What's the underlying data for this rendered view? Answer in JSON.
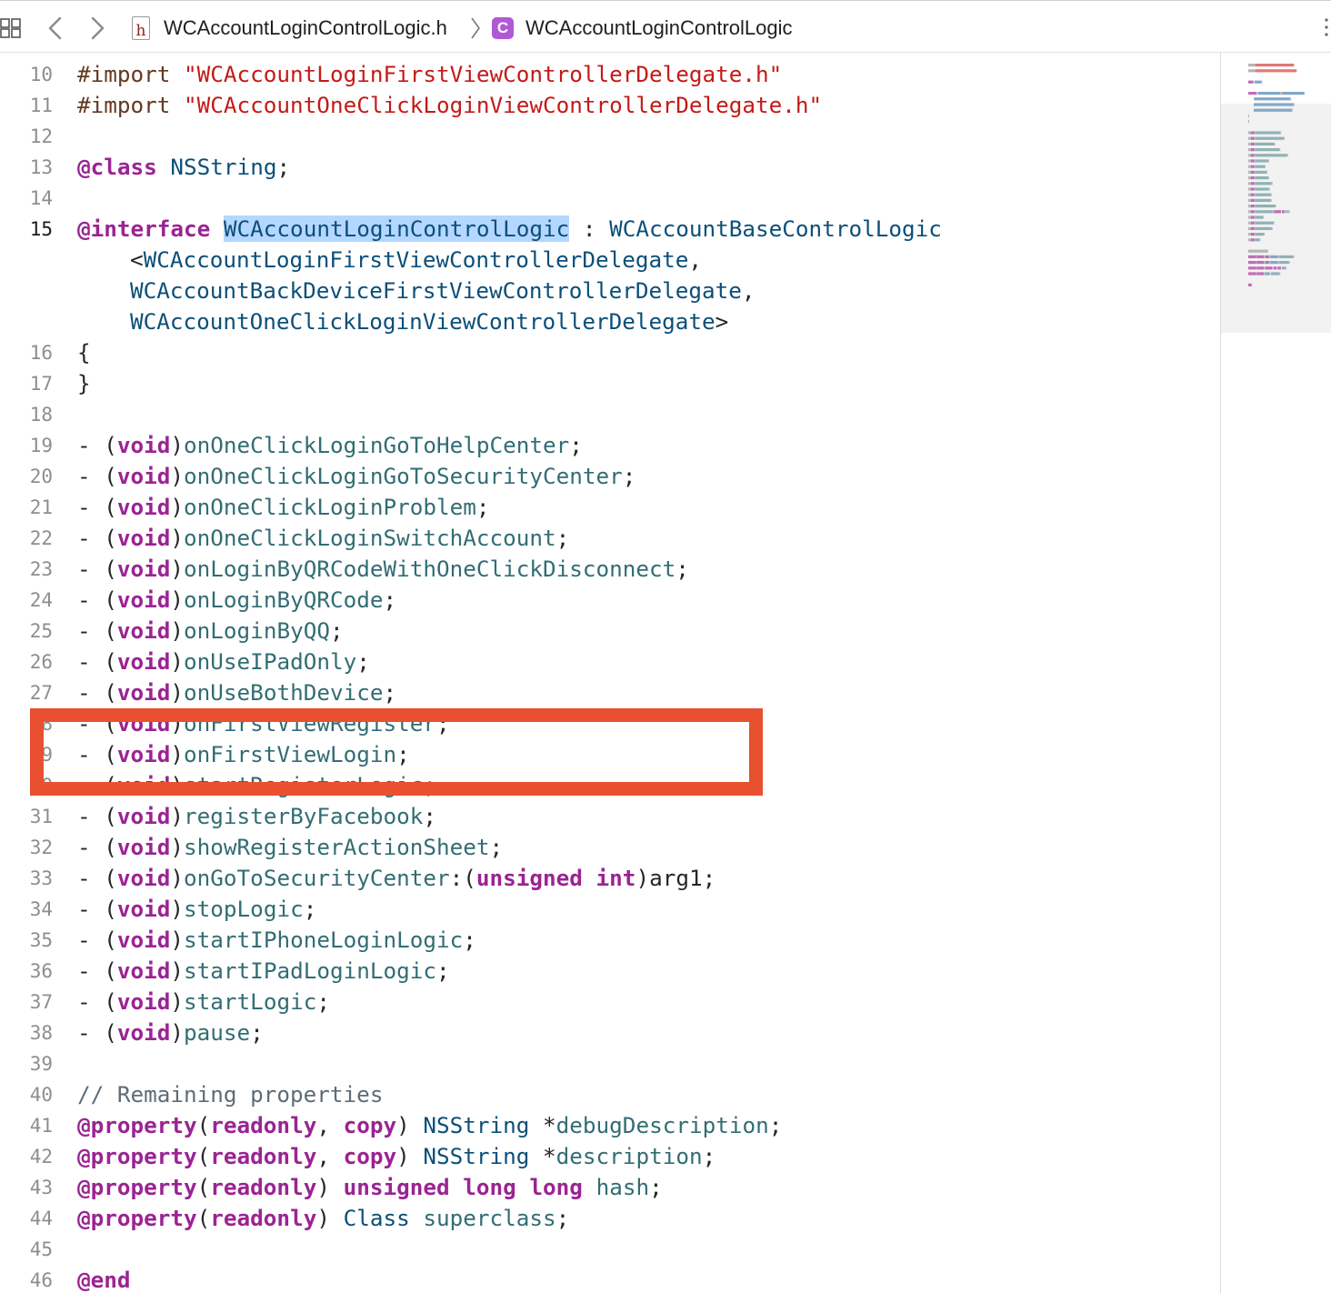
{
  "jump_bar": {
    "file_icon_glyph": "h",
    "file_name": "WCAccountLoginControlLogic.h",
    "class_icon_glyph": "C",
    "class_name": "WCAccountLoginControlLogic",
    "class_icon_color": "#b159d4"
  },
  "icons": {
    "grid": "grid-icon",
    "back": "chevron-left-icon",
    "forward": "chevron-right-icon",
    "separator": "chevron-right-icon",
    "more": "vertical-dots-icon"
  },
  "annotation": {
    "color": "#e8502f"
  },
  "editor": {
    "current_line": "15",
    "lines": [
      {
        "n": "10",
        "tokens": [
          [
            "pp",
            "#import "
          ],
          [
            "str",
            "\"WCAccountLoginFirstViewControllerDelegate.h\""
          ]
        ]
      },
      {
        "n": "11",
        "tokens": [
          [
            "pp",
            "#import "
          ],
          [
            "str",
            "\"WCAccountOneClickLoginViewControllerDelegate.h\""
          ]
        ]
      },
      {
        "n": "12",
        "tokens": []
      },
      {
        "n": "13",
        "tokens": [
          [
            "kw",
            "@class"
          ],
          [
            "p",
            " "
          ],
          [
            "ty",
            "NSString"
          ],
          [
            "p",
            ";"
          ]
        ]
      },
      {
        "n": "14",
        "tokens": []
      },
      {
        "n": "15",
        "tokens": [
          [
            "kw",
            "@interface"
          ],
          [
            "p",
            " "
          ],
          [
            "ty sel",
            "WCAccountLoginControlLogic"
          ],
          [
            "p",
            " : "
          ],
          [
            "ty",
            "WCAccountBaseControlLogic"
          ]
        ]
      },
      {
        "n": "",
        "wrap": true,
        "tokens": [
          [
            "p",
            "<"
          ],
          [
            "ty",
            "WCAccountLoginFirstViewControllerDelegate"
          ],
          [
            "p",
            ","
          ]
        ]
      },
      {
        "n": "",
        "wrap": true,
        "tokens": [
          [
            "ty",
            "WCAccountBackDeviceFirstViewControllerDelegate"
          ],
          [
            "p",
            ","
          ]
        ]
      },
      {
        "n": "",
        "wrap": true,
        "tokens": [
          [
            "ty",
            "WCAccountOneClickLoginViewControllerDelegate"
          ],
          [
            "p",
            ">"
          ]
        ]
      },
      {
        "n": "16",
        "tokens": [
          [
            "p",
            "{"
          ]
        ]
      },
      {
        "n": "17",
        "tokens": [
          [
            "p",
            "}"
          ]
        ]
      },
      {
        "n": "18",
        "tokens": []
      },
      {
        "n": "19",
        "tokens": [
          [
            "p",
            "- ("
          ],
          [
            "kw",
            "void"
          ],
          [
            "p",
            ")"
          ],
          [
            "fn",
            "onOneClickLoginGoToHelpCenter"
          ],
          [
            "p",
            ";"
          ]
        ]
      },
      {
        "n": "20",
        "tokens": [
          [
            "p",
            "- ("
          ],
          [
            "kw",
            "void"
          ],
          [
            "p",
            ")"
          ],
          [
            "fn",
            "onOneClickLoginGoToSecurityCenter"
          ],
          [
            "p",
            ";"
          ]
        ]
      },
      {
        "n": "21",
        "tokens": [
          [
            "p",
            "- ("
          ],
          [
            "kw",
            "void"
          ],
          [
            "p",
            ")"
          ],
          [
            "fn",
            "onOneClickLoginProblem"
          ],
          [
            "p",
            ";"
          ]
        ]
      },
      {
        "n": "22",
        "tokens": [
          [
            "p",
            "- ("
          ],
          [
            "kw",
            "void"
          ],
          [
            "p",
            ")"
          ],
          [
            "fn",
            "onOneClickLoginSwitchAccount"
          ],
          [
            "p",
            ";"
          ]
        ]
      },
      {
        "n": "23",
        "tokens": [
          [
            "p",
            "- ("
          ],
          [
            "kw",
            "void"
          ],
          [
            "p",
            ")"
          ],
          [
            "fn",
            "onLoginByQRCodeWithOneClickDisconnect"
          ],
          [
            "p",
            ";"
          ]
        ]
      },
      {
        "n": "24",
        "tokens": [
          [
            "p",
            "- ("
          ],
          [
            "kw",
            "void"
          ],
          [
            "p",
            ")"
          ],
          [
            "fn",
            "onLoginByQRCode"
          ],
          [
            "p",
            ";"
          ]
        ]
      },
      {
        "n": "25",
        "tokens": [
          [
            "p",
            "- ("
          ],
          [
            "kw",
            "void"
          ],
          [
            "p",
            ")"
          ],
          [
            "fn",
            "onLoginByQQ"
          ],
          [
            "p",
            ";"
          ]
        ]
      },
      {
        "n": "26",
        "tokens": [
          [
            "p",
            "- ("
          ],
          [
            "kw",
            "void"
          ],
          [
            "p",
            ")"
          ],
          [
            "fn",
            "onUseIPadOnly"
          ],
          [
            "p",
            ";"
          ]
        ]
      },
      {
        "n": "27",
        "tokens": [
          [
            "p",
            "- ("
          ],
          [
            "kw",
            "void"
          ],
          [
            "p",
            ")"
          ],
          [
            "fn",
            "onUseBothDevice"
          ],
          [
            "p",
            ";"
          ]
        ]
      },
      {
        "n": "28",
        "tokens": [
          [
            "p",
            "- ("
          ],
          [
            "kw",
            "void"
          ],
          [
            "p",
            ")"
          ],
          [
            "fn",
            "onFirstViewRegister"
          ],
          [
            "p",
            ";"
          ]
        ]
      },
      {
        "n": "29",
        "tokens": [
          [
            "p",
            "- ("
          ],
          [
            "kw",
            "void"
          ],
          [
            "p",
            ")"
          ],
          [
            "fn",
            "onFirstViewLogin"
          ],
          [
            "p",
            ";"
          ]
        ]
      },
      {
        "n": "30",
        "tokens": [
          [
            "p",
            "- ("
          ],
          [
            "kw",
            "void"
          ],
          [
            "p",
            ")"
          ],
          [
            "fn",
            "startRegisterLogic"
          ],
          [
            "p",
            ";"
          ]
        ]
      },
      {
        "n": "31",
        "tokens": [
          [
            "p",
            "- ("
          ],
          [
            "kw",
            "void"
          ],
          [
            "p",
            ")"
          ],
          [
            "fn",
            "registerByFacebook"
          ],
          [
            "p",
            ";"
          ]
        ]
      },
      {
        "n": "32",
        "tokens": [
          [
            "p",
            "- ("
          ],
          [
            "kw",
            "void"
          ],
          [
            "p",
            ")"
          ],
          [
            "fn",
            "showRegisterActionSheet"
          ],
          [
            "p",
            ";"
          ]
        ]
      },
      {
        "n": "33",
        "tokens": [
          [
            "p",
            "- ("
          ],
          [
            "kw",
            "void"
          ],
          [
            "p",
            ")"
          ],
          [
            "fn",
            "onGoToSecurityCenter"
          ],
          [
            "p",
            ":("
          ],
          [
            "kw",
            "unsigned"
          ],
          [
            "p",
            " "
          ],
          [
            "kw",
            "int"
          ],
          [
            "p",
            ")arg1;"
          ]
        ]
      },
      {
        "n": "34",
        "tokens": [
          [
            "p",
            "- ("
          ],
          [
            "kw",
            "void"
          ],
          [
            "p",
            ")"
          ],
          [
            "fn",
            "stopLogic"
          ],
          [
            "p",
            ";"
          ]
        ]
      },
      {
        "n": "35",
        "tokens": [
          [
            "p",
            "- ("
          ],
          [
            "kw",
            "void"
          ],
          [
            "p",
            ")"
          ],
          [
            "fn",
            "startIPhoneLoginLogic"
          ],
          [
            "p",
            ";"
          ]
        ]
      },
      {
        "n": "36",
        "tokens": [
          [
            "p",
            "- ("
          ],
          [
            "kw",
            "void"
          ],
          [
            "p",
            ")"
          ],
          [
            "fn",
            "startIPadLoginLogic"
          ],
          [
            "p",
            ";"
          ]
        ]
      },
      {
        "n": "37",
        "tokens": [
          [
            "p",
            "- ("
          ],
          [
            "kw",
            "void"
          ],
          [
            "p",
            ")"
          ],
          [
            "fn",
            "startLogic"
          ],
          [
            "p",
            ";"
          ]
        ]
      },
      {
        "n": "38",
        "tokens": [
          [
            "p",
            "- ("
          ],
          [
            "kw",
            "void"
          ],
          [
            "p",
            ")"
          ],
          [
            "fn",
            "pause"
          ],
          [
            "p",
            ";"
          ]
        ]
      },
      {
        "n": "39",
        "tokens": []
      },
      {
        "n": "40",
        "tokens": [
          [
            "cm",
            "// Remaining properties"
          ]
        ]
      },
      {
        "n": "41",
        "tokens": [
          [
            "kw",
            "@property"
          ],
          [
            "p",
            "("
          ],
          [
            "kw",
            "readonly"
          ],
          [
            "p",
            ", "
          ],
          [
            "kw",
            "copy"
          ],
          [
            "p",
            ") "
          ],
          [
            "ty",
            "NSString"
          ],
          [
            "p",
            " *"
          ],
          [
            "fn",
            "debugDescription"
          ],
          [
            "p",
            ";"
          ]
        ]
      },
      {
        "n": "42",
        "tokens": [
          [
            "kw",
            "@property"
          ],
          [
            "p",
            "("
          ],
          [
            "kw",
            "readonly"
          ],
          [
            "p",
            ", "
          ],
          [
            "kw",
            "copy"
          ],
          [
            "p",
            ") "
          ],
          [
            "ty",
            "NSString"
          ],
          [
            "p",
            " *"
          ],
          [
            "fn",
            "description"
          ],
          [
            "p",
            ";"
          ]
        ]
      },
      {
        "n": "43",
        "tokens": [
          [
            "kw",
            "@property"
          ],
          [
            "p",
            "("
          ],
          [
            "kw",
            "readonly"
          ],
          [
            "p",
            ") "
          ],
          [
            "kw",
            "unsigned"
          ],
          [
            "p",
            " "
          ],
          [
            "kw",
            "long"
          ],
          [
            "p",
            " "
          ],
          [
            "kw",
            "long"
          ],
          [
            "p",
            " "
          ],
          [
            "fn",
            "hash"
          ],
          [
            "p",
            ";"
          ]
        ]
      },
      {
        "n": "44",
        "tokens": [
          [
            "kw",
            "@property"
          ],
          [
            "p",
            "("
          ],
          [
            "kw",
            "readonly"
          ],
          [
            "p",
            ") "
          ],
          [
            "ty",
            "Class"
          ],
          [
            "p",
            " "
          ],
          [
            "fn",
            "superclass"
          ],
          [
            "p",
            ";"
          ]
        ]
      },
      {
        "n": "45",
        "tokens": []
      },
      {
        "n": "46",
        "tokens": [
          [
            "kw",
            "@end"
          ]
        ]
      }
    ]
  },
  "minimap": {
    "colors": {
      "keyword": "#c36bb8",
      "string": "#e07a74",
      "type": "#7fa8c9",
      "function": "#8fb2b6",
      "plain": "#b5b5b5"
    }
  }
}
